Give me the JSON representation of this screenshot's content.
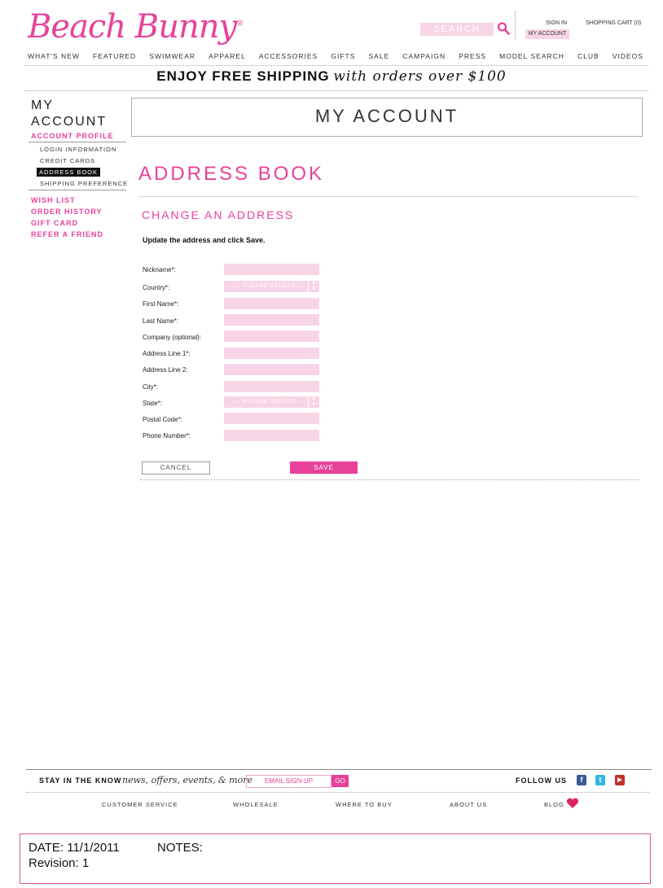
{
  "header": {
    "logo": "Beach Bunny",
    "logo_mark": "®",
    "search_placeholder": "SEARCH",
    "sign_in": "SIGN IN",
    "my_account": "MY ACCOUNT",
    "cart": "SHOPPING CART (0)"
  },
  "nav": [
    "WHAT'S NEW",
    "FEATURED",
    "SWIMWEAR",
    "APPAREL",
    "ACCESSORIES",
    "GIFTS",
    "SALE",
    "CAMPAIGN",
    "PRESS",
    "MODEL SEARCH",
    "CLUB",
    "VIDEOS"
  ],
  "promo": {
    "bold": "ENJOY FREE SHIPPING",
    "italic": "with orders over $100"
  },
  "sidebar": {
    "title_1": "MY",
    "title_2": "ACCOUNT",
    "section": "ACCOUNT PROFILE",
    "sub_items": [
      "LOGIN INFORMATION",
      "CREDIT CARDS",
      "ADDRESS BOOK",
      "SHIPPING PREFERENCE"
    ],
    "links": [
      "WISH LIST",
      "ORDER HISTORY",
      "GIFT CARD",
      "REFER A FRIEND"
    ]
  },
  "main": {
    "account_title": "MY ACCOUNT",
    "address_title": "ADDRESS BOOK",
    "change_title": "CHANGE AN ADDRESS",
    "instruction": "Update the address and click Save.",
    "fields": {
      "nickname": "Nickname*:",
      "country": "Country*:",
      "first_name": "First Name*:",
      "last_name": "Last Name*:",
      "company": "Company (optional):",
      "address1": "Address Line 1*:",
      "address2": "Address Line 2:",
      "city": "City*:",
      "state": "State*:",
      "postal": "Postal Code*:",
      "phone": "Phone Number*:"
    },
    "select_placeholder": "-- PLEASE SELECT --",
    "cancel": "CANCEL",
    "save": "SAVE"
  },
  "footer": {
    "stay": "STAY IN THE KNOW",
    "stay_italic": "news, offers, events, & more",
    "email_placeholder": "EMAIL SIGN-UP",
    "go": "GO",
    "follow": "FOLLOW US",
    "links": [
      "CUSTOMER SERVICE",
      "WHOLESALE",
      "WHERE TO BUY",
      "ABOUT US",
      "BLOG"
    ]
  },
  "notes": {
    "date": "DATE: 11/1/2011",
    "revision": "Revision: 1",
    "notes": "NOTES:"
  }
}
